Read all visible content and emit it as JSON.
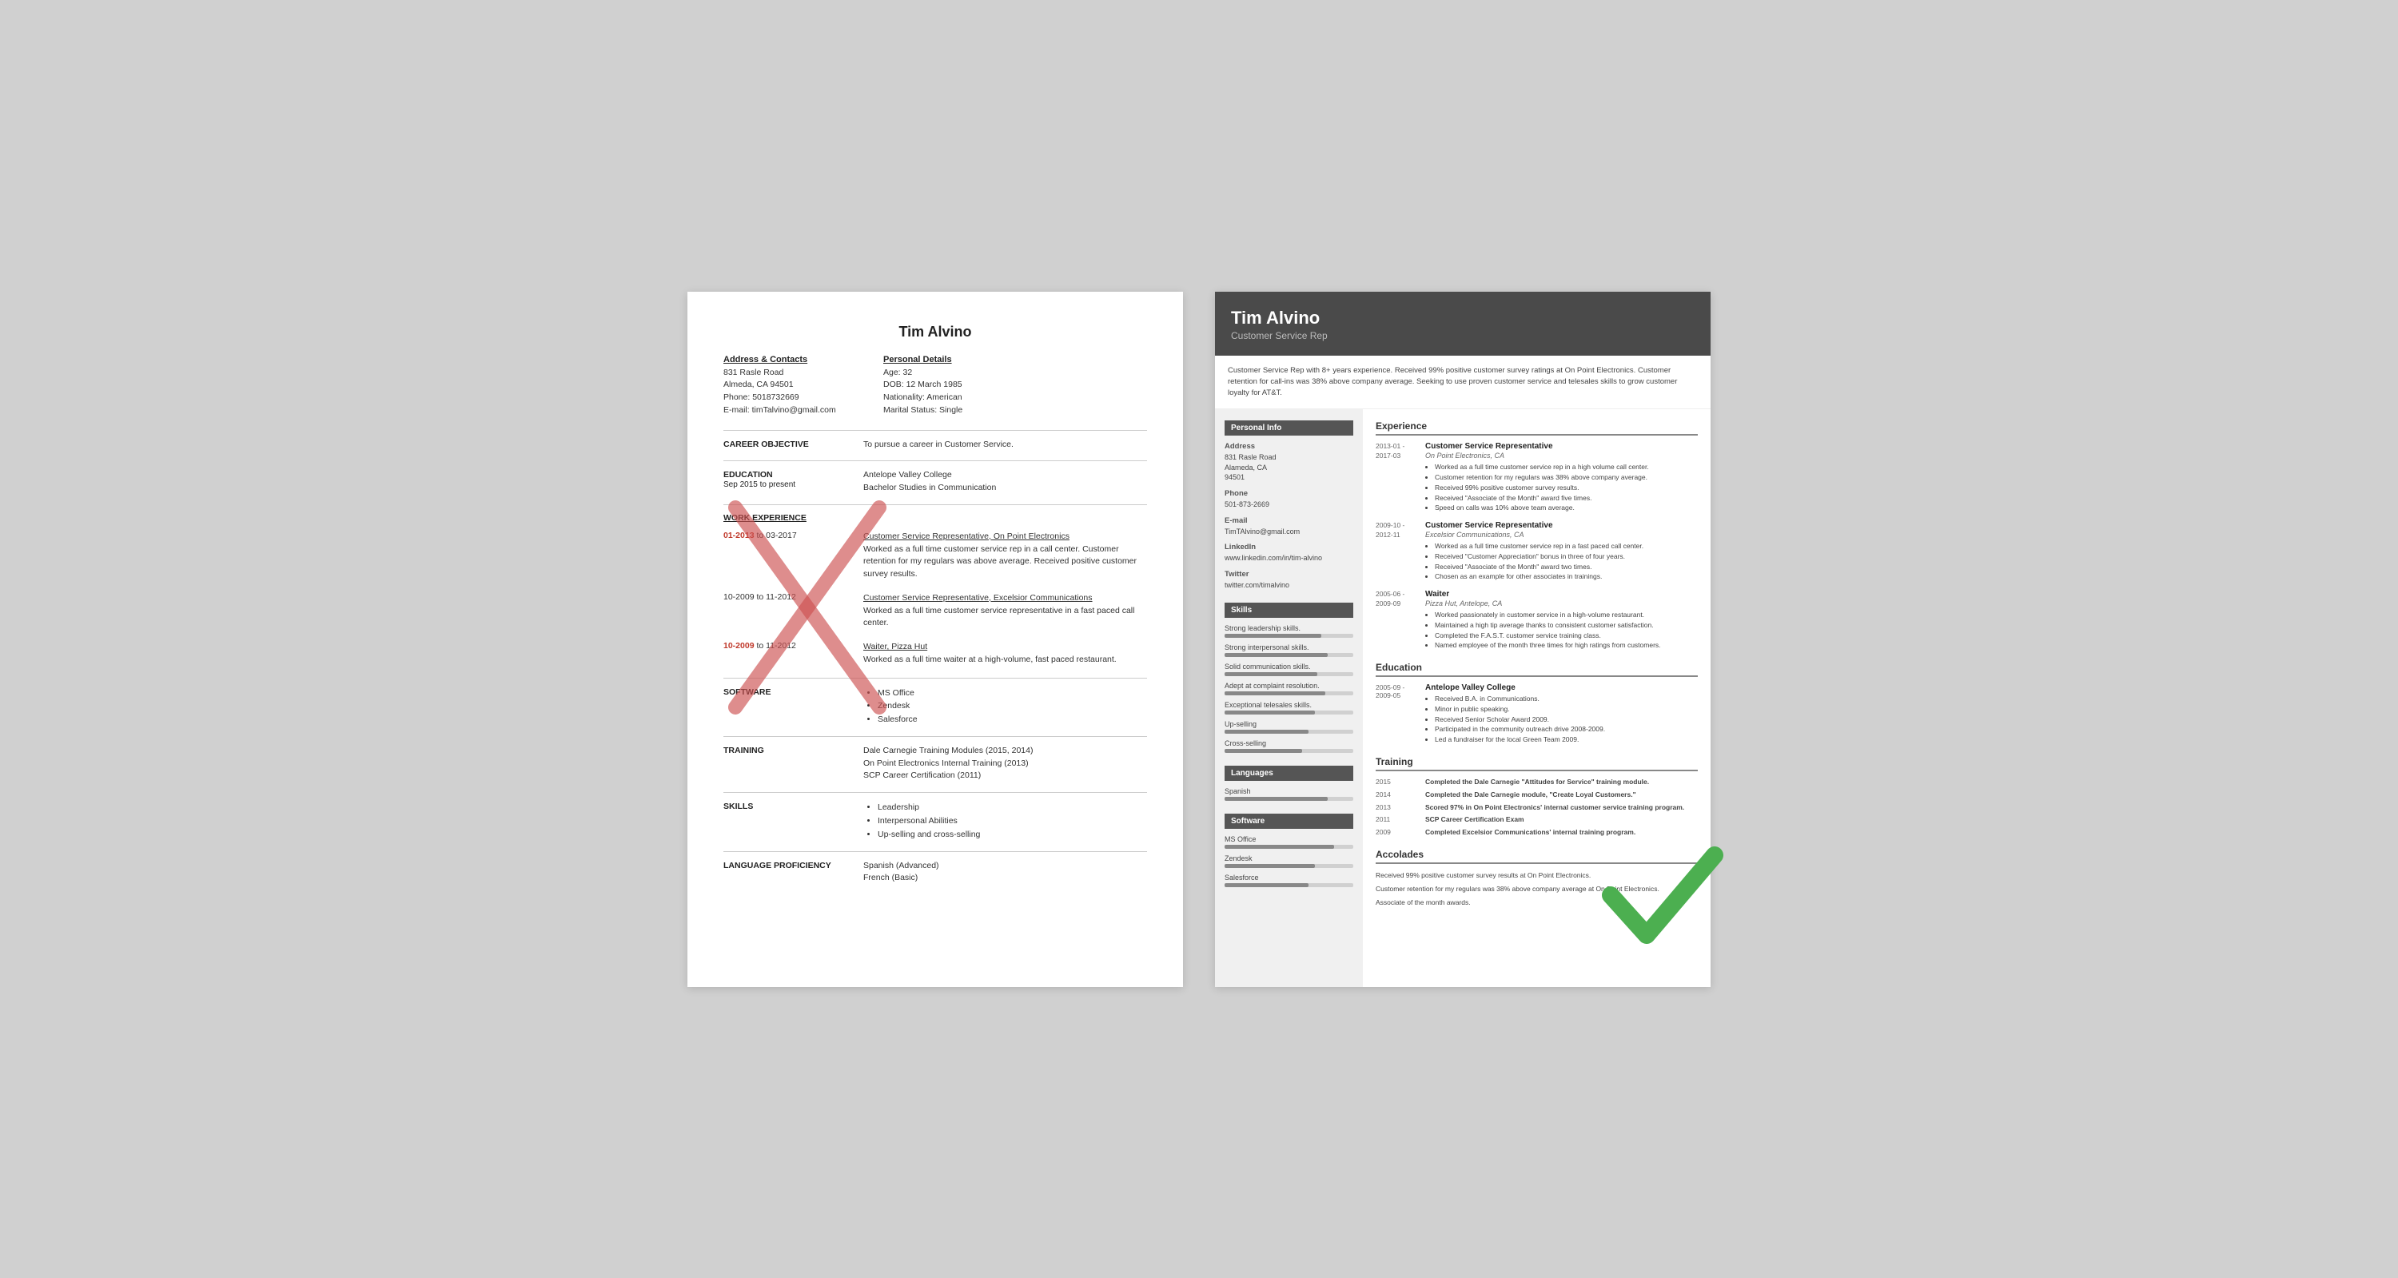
{
  "bad_resume": {
    "name": "Tim Alvino",
    "address_heading": "Address & Contacts",
    "address_lines": [
      "831 Rasle Road",
      "Almeda, CA 94501",
      "Phone: 5018732669",
      "E-mail: timTalvino@gmail.com"
    ],
    "personal_heading": "Personal Details",
    "personal_lines": [
      "Age:   32",
      "DOB:  12 March 1985",
      "Nationality: American",
      "Marital Status: Single"
    ],
    "career_obj_label": "CAREER OBJECTIVE",
    "career_obj_text": "To pursue a career in Customer Service.",
    "education_label": "EDUCATION",
    "education_date": "Sep 2015 to present",
    "education_text": [
      "Antelope Valley College",
      "Bachelor Studies in Communication"
    ],
    "work_label": "WORK EXPERIENCE",
    "work_entries": [
      {
        "date": "01-2013 to 03-2017",
        "highlight": "01-2013",
        "title": "Customer Service Representative, On Point Electronics",
        "desc": "Worked as a full time customer service rep in a call center. Customer retention for my regulars was above average. Received positive customer survey results."
      },
      {
        "date": "10-2009 to 11-2012",
        "highlight": "",
        "title": "Customer Service Representative, Excelsior Communications",
        "desc": "Worked as a full time customer service representative in a fast paced call center."
      },
      {
        "date": "10-2009 to 11-2012",
        "highlight": "10-2009",
        "title": "Waiter, Pizza Hut",
        "desc": "Worked as a full time waiter at a high-volume, fast paced restaurant."
      }
    ],
    "software_label": "SOFTWARE",
    "software_items": [
      "MS Office",
      "Zendesk",
      "Salesforce"
    ],
    "training_label": "TRAINING",
    "training_items": [
      "Dale Carnegie Training Modules (2015, 2014)",
      "On Point Electronics Internal Training (2013)",
      "SCP Career Certification (2011)"
    ],
    "skills_label": "SKILLS",
    "skills_items": [
      "Leadership",
      "Interpersonal Abilities",
      "Up-selling and cross-selling"
    ],
    "language_label": "LANGUAGE PROFICIENCY",
    "language_items": [
      "Spanish (Advanced)",
      "French (Basic)"
    ]
  },
  "good_resume": {
    "name": "Tim Alvino",
    "title": "Customer Service Rep",
    "summary": "Customer Service Rep with 8+ years experience. Received 99% positive customer survey ratings at On Point Electronics. Customer retention for call-ins was 38% above company average. Seeking to use proven customer service and telesales skills to grow customer loyalty for AT&T.",
    "sidebar": {
      "personal_section": "Personal Info",
      "address_label": "Address",
      "address_value": "831 Rasle Road\nAlameda, CA\n94501",
      "phone_label": "Phone",
      "phone_value": "501-873-2669",
      "email_label": "E-mail",
      "email_value": "TimTAlvino@gmail.com",
      "linkedin_label": "LinkedIn",
      "linkedin_value": "www.linkedin.com/in/tim-alvino",
      "twitter_label": "Twitter",
      "twitter_value": "twitter.com/timalvino",
      "skills_section": "Skills",
      "skills": [
        {
          "name": "Strong leadership skills.",
          "pct": 75
        },
        {
          "name": "Strong interpersonal skills.",
          "pct": 80
        },
        {
          "name": "Solid communication skills.",
          "pct": 72
        },
        {
          "name": "Adept at complaint resolution.",
          "pct": 78
        },
        {
          "name": "Exceptional telesales skills.",
          "pct": 70
        },
        {
          "name": "Up-selling",
          "pct": 65
        },
        {
          "name": "Cross-selling",
          "pct": 60
        }
      ],
      "languages_section": "Languages",
      "languages": [
        {
          "name": "Spanish",
          "pct": 80
        }
      ],
      "software_section": "Software",
      "software": [
        {
          "name": "MS Office",
          "pct": 85
        },
        {
          "name": "Zendesk",
          "pct": 70
        },
        {
          "name": "Salesforce",
          "pct": 65
        }
      ]
    },
    "main": {
      "experience_title": "Experience",
      "experience": [
        {
          "date": "2013-01 -\n2017-03",
          "job_title": "Customer Service Representative",
          "company": "On Point Electronics, CA",
          "bullets": [
            "Worked as a full time customer service rep in a high volume call center.",
            "Customer retention for my regulars was 38% above company average.",
            "Received 99% positive customer survey results.",
            "Received \"Associate of the Month\" award five times.",
            "Speed on calls was 10% above team average."
          ]
        },
        {
          "date": "2009-10 -\n2012-11",
          "job_title": "Customer Service Representative",
          "company": "Excelsior Communications, CA",
          "bullets": [
            "Worked as a full time customer service rep in a fast paced call center.",
            "Received \"Customer Appreciation\" bonus in three of four years.",
            "Received \"Associate of the Month\" award two times.",
            "Chosen as an example for other associates in trainings."
          ]
        },
        {
          "date": "2005-06 -\n2009-09",
          "job_title": "Waiter",
          "company": "Pizza Hut, Antelope, CA",
          "bullets": [
            "Worked passionately in customer service in a high-volume restaurant.",
            "Maintained a high tip average thanks to consistent customer satisfaction.",
            "Completed the F.A.S.T. customer service training class.",
            "Named employee of the month three times for high ratings from customers."
          ]
        }
      ],
      "education_title": "Education",
      "education": [
        {
          "date": "2005-09 -\n2009-05",
          "school": "Antelope Valley College",
          "bullets": [
            "Received B.A. in Communications.",
            "Minor in public speaking.",
            "Received Senior Scholar Award 2009.",
            "Participated in the community outreach drive 2008-2009.",
            "Led a fundraiser for the local Green Team 2009."
          ]
        }
      ],
      "training_title": "Training",
      "training": [
        {
          "year": "2015",
          "text": "Completed the Dale Carnegie \"Attitudes for Service\" training module."
        },
        {
          "year": "2014",
          "text": "Completed the Dale Carnegie module, \"Create Loyal Customers.\""
        },
        {
          "year": "2013",
          "text": "Scored 97% in On Point Electronics' internal customer service training program."
        },
        {
          "year": "2011",
          "text": "SCP Career Certification Exam"
        },
        {
          "year": "2009",
          "text": "Completed Excelsior Communications' internal training program."
        }
      ],
      "accolades_title": "Accolades",
      "accolades": [
        "Received 99% positive customer survey results at On Point Electronics.",
        "Customer retention for my regulars was 38% above company average at On Point Electronics.",
        "Associate of the month awards."
      ]
    }
  }
}
